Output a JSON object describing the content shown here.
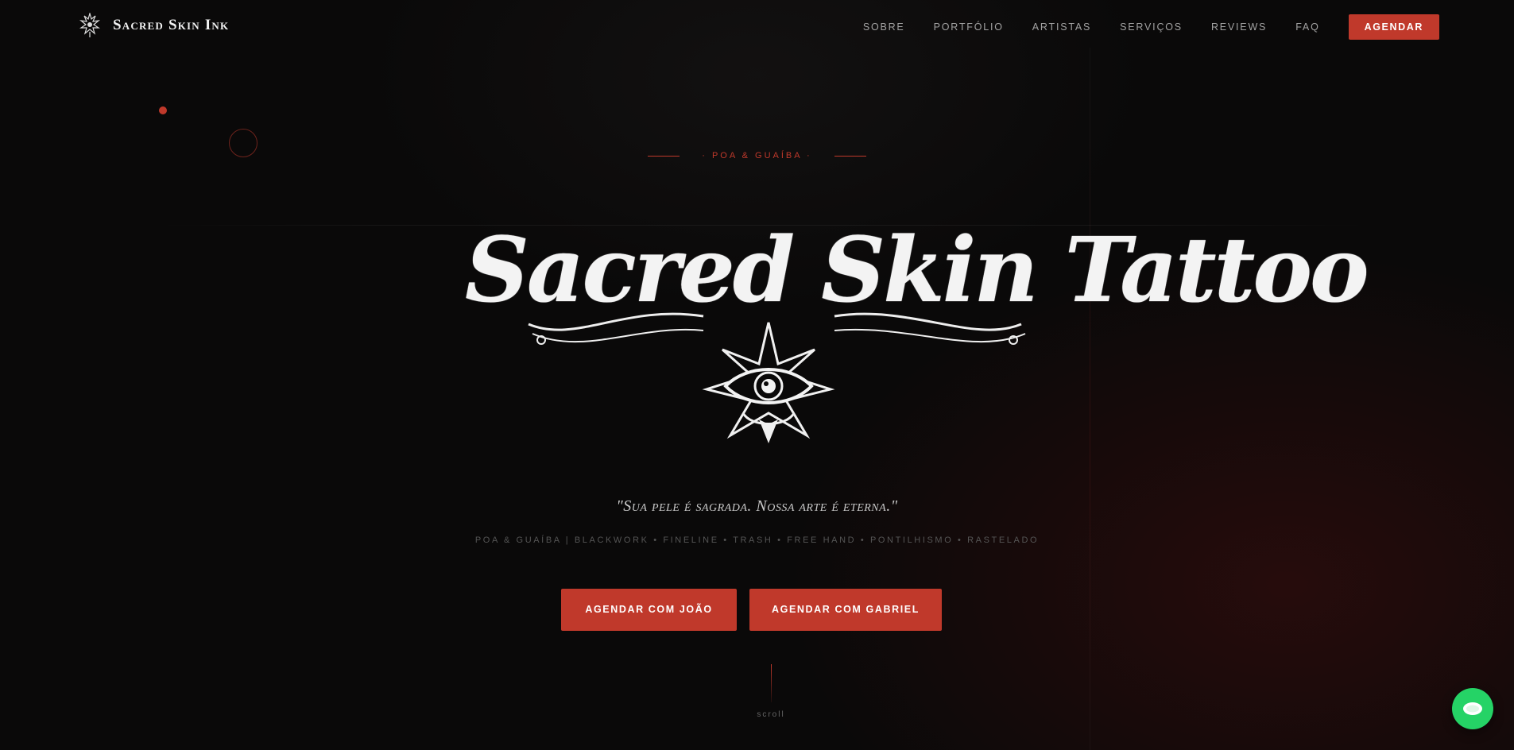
{
  "header": {
    "brand": "Sacred Skin Ink",
    "brand_icon": "ornament-eye-icon",
    "nav": [
      "SOBRE",
      "PORTFÓLIO",
      "ARTISTAS",
      "SERVIÇOS",
      "REVIEWS",
      "FAQ"
    ],
    "cta": "AGENDAR"
  },
  "hero": {
    "eyebrow": "· POA & GUAÍBA ·",
    "logo_text": "Sacred Skin Tattoo",
    "logo_emblem": "all-seeing-eye-emblem",
    "tagline": "\"Sua pele é sagrada. Nossa arte é eterna.\"",
    "subline": "POA & GUAÍBA | BLACKWORK • FINELINE • TRASH • FREE HAND • PONTILHISMO • RASTELADO",
    "buttons": [
      "AGENDAR COM JOÃO",
      "AGENDAR COM GABRIEL"
    ],
    "scroll": "scroll"
  },
  "floating": {
    "chat_icon": "whatsapp-chat-icon"
  },
  "colors": {
    "accent": "#c0392b",
    "background": "#0a0909",
    "whatsapp": "#25d366"
  }
}
